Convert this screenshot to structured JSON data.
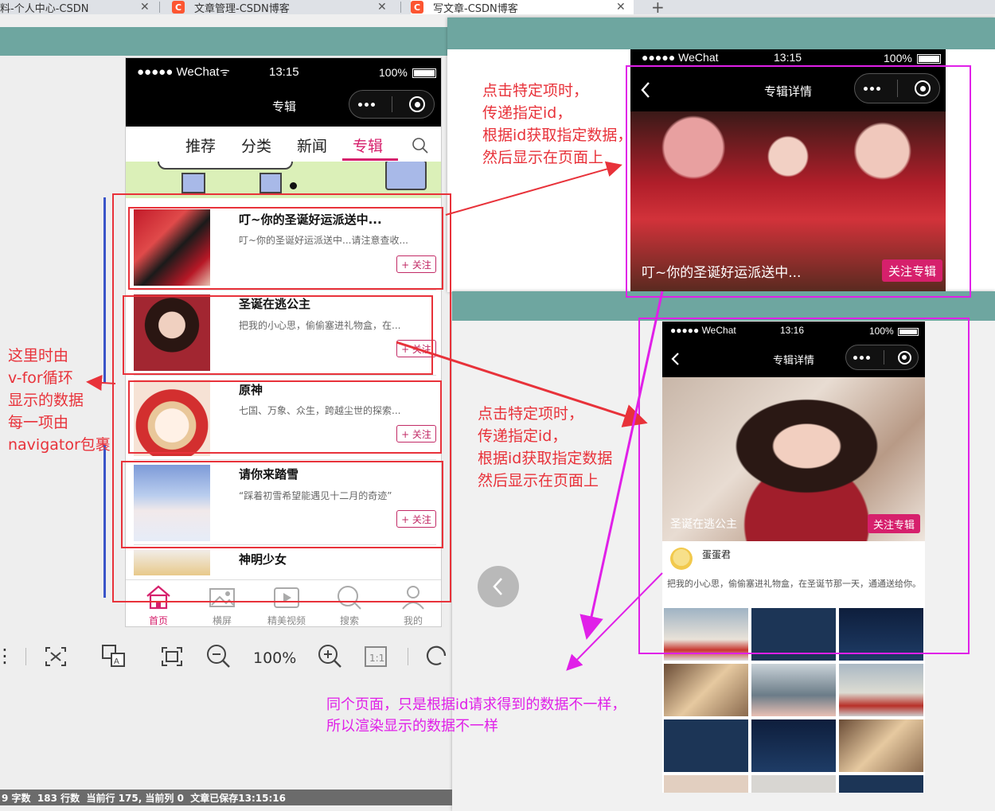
{
  "browser": {
    "tabs": [
      {
        "label": "料-个人中心-CSDN"
      },
      {
        "label": "文章管理-CSDN博客"
      },
      {
        "label": "写文章-CSDN博客"
      }
    ],
    "new_tab": "+",
    "close": "✕"
  },
  "phone_left": {
    "status": {
      "carrier": "●●●●● WeChat",
      "time": "13:15",
      "battery": "100%"
    },
    "nav_title": "专辑",
    "top_tabs": [
      "推荐",
      "分类",
      "新闻",
      "专辑"
    ],
    "items": [
      {
        "title": "叮~你的圣诞好运派送中...",
        "desc": "叮~你的圣诞好运派送中...请注意查收...",
        "follow": "+ 关注"
      },
      {
        "title": "圣诞在逃公主",
        "desc": "把我的小心思，偷偷塞进礼物盒，在...",
        "follow": "+ 关注"
      },
      {
        "title": "原神",
        "desc": "七国、万象、众生，跨越尘世的探索...",
        "follow": "+ 关注"
      },
      {
        "title": "请你来踏雪",
        "desc": "“踩着初雪希望能遇见十二月的奇迹”",
        "follow": "+ 关注"
      },
      {
        "title": "神明少女",
        "desc": "",
        "follow": ""
      }
    ],
    "bottom_tabs": [
      "首页",
      "横屏",
      "精美视频",
      "搜索",
      "我的"
    ]
  },
  "phone_top_right": {
    "status": {
      "carrier": "●●●●● WeChat",
      "time": "13:15",
      "battery": "100%"
    },
    "nav_title": "专辑详情",
    "cover_caption": "叮~你的圣诞好运派送中...",
    "follow_album": "关注专辑"
  },
  "phone_bottom_right": {
    "status": {
      "carrier": "●●●●● WeChat",
      "time": "13:16",
      "battery": "100%"
    },
    "nav_title": "专辑详情",
    "cover_caption": "圣诞在逃公主",
    "follow_album": "关注专辑",
    "author": "蛋蛋君",
    "intro": "把我的小心思，偷偷塞进礼物盒，在圣诞节那一天，通通送给你。"
  },
  "annotations": {
    "left_note": [
      "这里时由",
      "v-for循环",
      "显示的数据",
      "每一项由",
      "navigator包裹"
    ],
    "note_top": [
      "点击特定项时，",
      "传递指定id，",
      "根据id获取指定数据，",
      "然后显示在页面上"
    ],
    "note_mid": [
      "点击特定项时，",
      "传递指定id，",
      "根据id获取指定数据",
      "然后显示在页面上"
    ],
    "note_bottom": [
      "同个页面，只是根据id请求得到的数据不一样，",
      "所以渲染显示的数据不一样"
    ]
  },
  "toolbar": {
    "zoom": "100%"
  },
  "statusbar": {
    "text": "9 字数  183 行数  当前行 175, 当前列 0  文章已保存13:15:16"
  },
  "colors": {
    "accent": "#d6206c",
    "annotation_red": "#e8323a",
    "annotation_magenta": "#e020e8",
    "teal": "#6ea6a0"
  }
}
